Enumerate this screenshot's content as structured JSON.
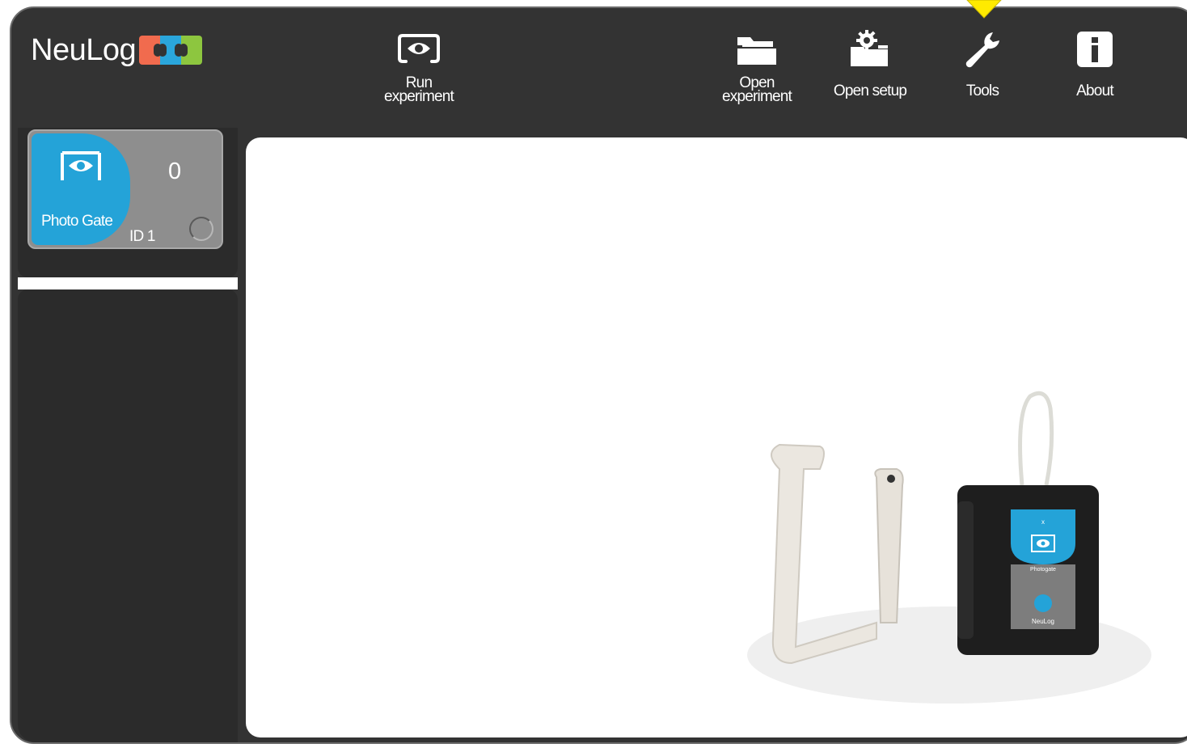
{
  "app": {
    "logo_text": "NeuLog"
  },
  "toolbar": {
    "run_experiment": {
      "line1": "Run",
      "line2": "experiment",
      "icon": "eye-icon"
    },
    "open_experiment": {
      "line1": "Open",
      "line2": "experiment",
      "icon": "folder-icon"
    },
    "open_setup": {
      "label": "Open setup",
      "icon": "gear-folder-icon"
    },
    "tools": {
      "label": "Tools",
      "icon": "wrench-icon"
    },
    "about": {
      "label": "About",
      "icon": "info-icon"
    }
  },
  "sensor": {
    "name": "Photo Gate",
    "value": "0",
    "id_label": "ID 1",
    "icon": "eye-icon",
    "color": "#24a3d8"
  },
  "device_image": {
    "label_top": "Photogate",
    "label_bottom": "NeuLog",
    "label_small": "x"
  },
  "colors": {
    "background": "#333333",
    "accent_blue": "#24a3d8",
    "logo_orange": "#f16b4e",
    "logo_green": "#8dc63f",
    "highlight_yellow": "#ffea00"
  }
}
